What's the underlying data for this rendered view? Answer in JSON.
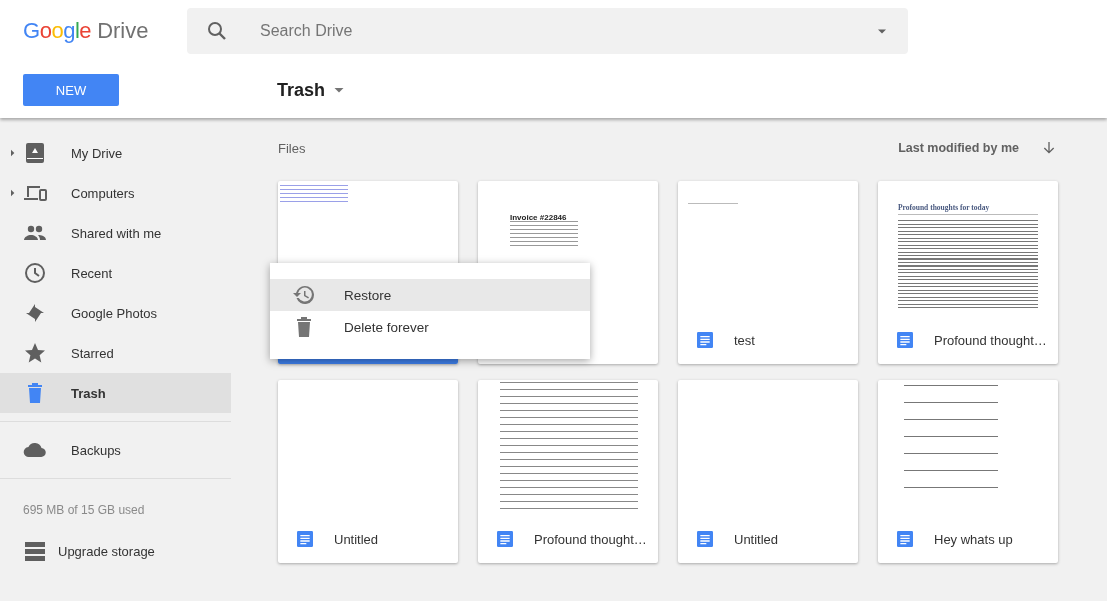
{
  "logo": {
    "brand": "Google",
    "product": "Drive"
  },
  "search": {
    "placeholder": "Search Drive"
  },
  "new_button": "NEW",
  "location": {
    "title": "Trash"
  },
  "sidebar": {
    "items": [
      {
        "label": "My Drive",
        "expandable": true,
        "selected": false
      },
      {
        "label": "Computers",
        "expandable": true,
        "selected": false
      },
      {
        "label": "Shared with me",
        "expandable": false,
        "selected": false
      },
      {
        "label": "Recent",
        "expandable": false,
        "selected": false
      },
      {
        "label": "Google Photos",
        "expandable": false,
        "selected": false
      },
      {
        "label": "Starred",
        "expandable": false,
        "selected": false
      },
      {
        "label": "Trash",
        "expandable": false,
        "selected": true
      }
    ],
    "backups": {
      "label": "Backups"
    },
    "storage": "695 MB of 15 GB used",
    "upgrade": "Upgrade storage"
  },
  "files": {
    "heading": "Files",
    "sort": "Last modified by me",
    "items": [
      {
        "selected": true
      },
      {
        "preview_title": "Invoice #22846",
        "selected": false
      },
      {
        "title": "test",
        "selected": false
      },
      {
        "title": "Profound thought…",
        "preview_title": "Profound thoughts for today",
        "selected": false
      },
      {
        "title": "Untitled",
        "selected": false
      },
      {
        "title": "Profound thought…",
        "selected": false
      },
      {
        "title": "Untitled",
        "selected": false
      },
      {
        "title": "Hey whats up",
        "selected": false
      }
    ]
  },
  "context_menu": {
    "items": [
      {
        "label": "Restore",
        "selected": true
      },
      {
        "label": "Delete forever",
        "selected": false
      }
    ]
  }
}
